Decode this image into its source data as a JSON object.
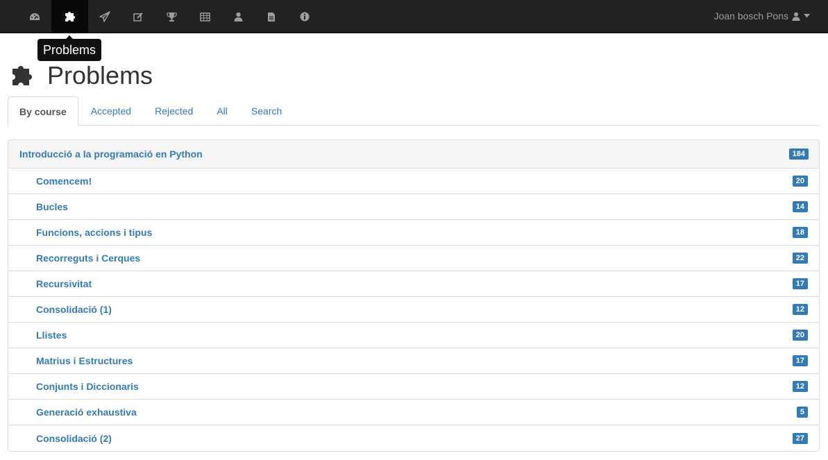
{
  "navbar": {
    "icons": [
      {
        "name": "dashboard-icon"
      },
      {
        "name": "puzzle-icon"
      },
      {
        "name": "paper-plane-icon"
      },
      {
        "name": "edit-icon"
      },
      {
        "name": "trophy-icon"
      },
      {
        "name": "table-icon"
      },
      {
        "name": "user-icon"
      },
      {
        "name": "document-icon"
      },
      {
        "name": "info-icon"
      }
    ],
    "active_index": 1,
    "user_name": "Joan bosch Pons"
  },
  "tooltip": "Problems",
  "page": {
    "title": "Problems"
  },
  "tabs": [
    {
      "label": "By course",
      "active": true
    },
    {
      "label": "Accepted"
    },
    {
      "label": "Rejected"
    },
    {
      "label": "All"
    },
    {
      "label": "Search"
    }
  ],
  "course": {
    "title": "Introducció a la programació en Python",
    "count": "184",
    "lists": [
      {
        "label": "Comencem!",
        "count": "20"
      },
      {
        "label": "Bucles",
        "count": "14"
      },
      {
        "label": "Funcions, accions i tipus",
        "count": "18"
      },
      {
        "label": "Recorreguts i Cerques",
        "count": "22"
      },
      {
        "label": "Recursivitat",
        "count": "17"
      },
      {
        "label": "Consolidació (1)",
        "count": "12"
      },
      {
        "label": "Llistes",
        "count": "20"
      },
      {
        "label": "Matrius i Estructures",
        "count": "17"
      },
      {
        "label": "Conjunts i Diccionaris",
        "count": "12"
      },
      {
        "label": "Generació exhaustiva",
        "count": "5"
      },
      {
        "label": "Consolidació (2)",
        "count": "27"
      }
    ]
  },
  "colors": {
    "navbar": "#222222",
    "link": "#337ab7",
    "badge": "#337ab7"
  }
}
